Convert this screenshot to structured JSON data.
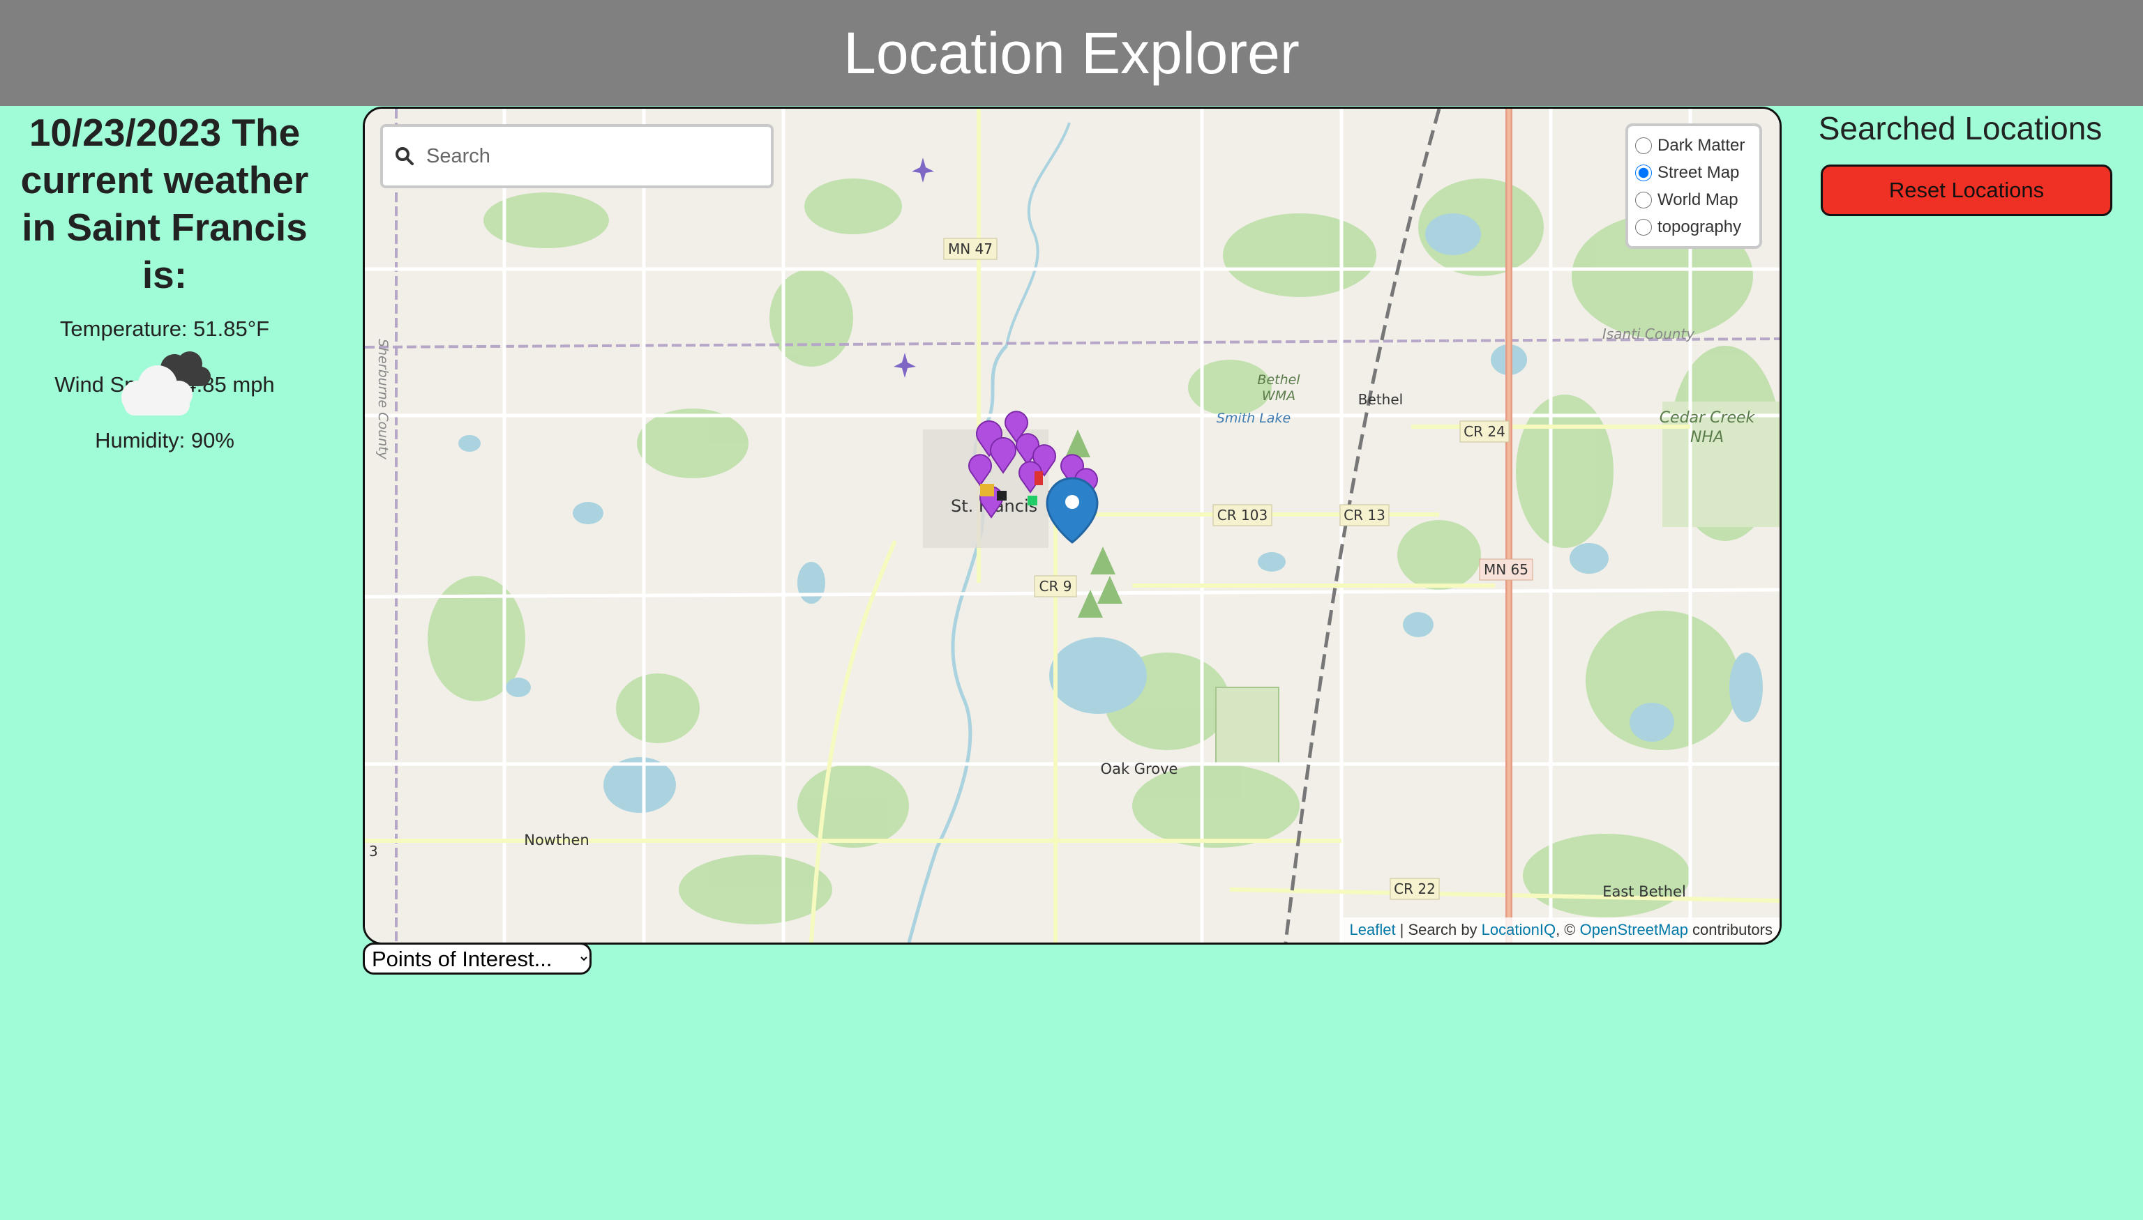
{
  "header": {
    "title": "Location Explorer"
  },
  "weather": {
    "heading": "10/23/2023 The current weather in Saint Francis is:",
    "temperature": "Temperature: 51.85°F",
    "wind_speed": "Wind Speed: 4.85 mph",
    "humidity": "Humidity: 90%",
    "icon": "cloudy-icon"
  },
  "map": {
    "search_placeholder": "Search",
    "layers": [
      {
        "label": "Dark Matter",
        "selected": false
      },
      {
        "label": "Street Map",
        "selected": true
      },
      {
        "label": "World Map",
        "selected": false
      },
      {
        "label": "topography",
        "selected": false
      }
    ],
    "place_labels": {
      "mn47": "MN 47",
      "isanti": "Isanti County",
      "bethel_wma_1": "Bethel",
      "bethel_wma_2": "WMA",
      "smith_lake": "Smith Lake",
      "bethel": "Bethel",
      "cr24": "CR 24",
      "cedar_creek_1": "Cedar Creek",
      "cedar_creek_2": "NHA",
      "cr103": "CR 103",
      "cr13": "CR 13",
      "mn65": "MN 65",
      "cr9": "CR 9",
      "oak_grove": "Oak Grove",
      "nowthen": "Nowthen",
      "cr22": "CR 22",
      "east_bethel": "East Bethel",
      "sherburne": "Sherburne County",
      "st_francis": "St. Francis",
      "left_edge": "3"
    },
    "attribution": {
      "leaflet": "Leaflet",
      "search_by": " | Search by ",
      "locationiq": "LocationIQ",
      "copyright": ", © ",
      "osm": "OpenStreetMap",
      "contributors": " contributors"
    }
  },
  "poi_dropdown": {
    "selected": "Points of Interest..."
  },
  "searched": {
    "title": "Searched Locations",
    "reset_label": "Reset Locations"
  }
}
